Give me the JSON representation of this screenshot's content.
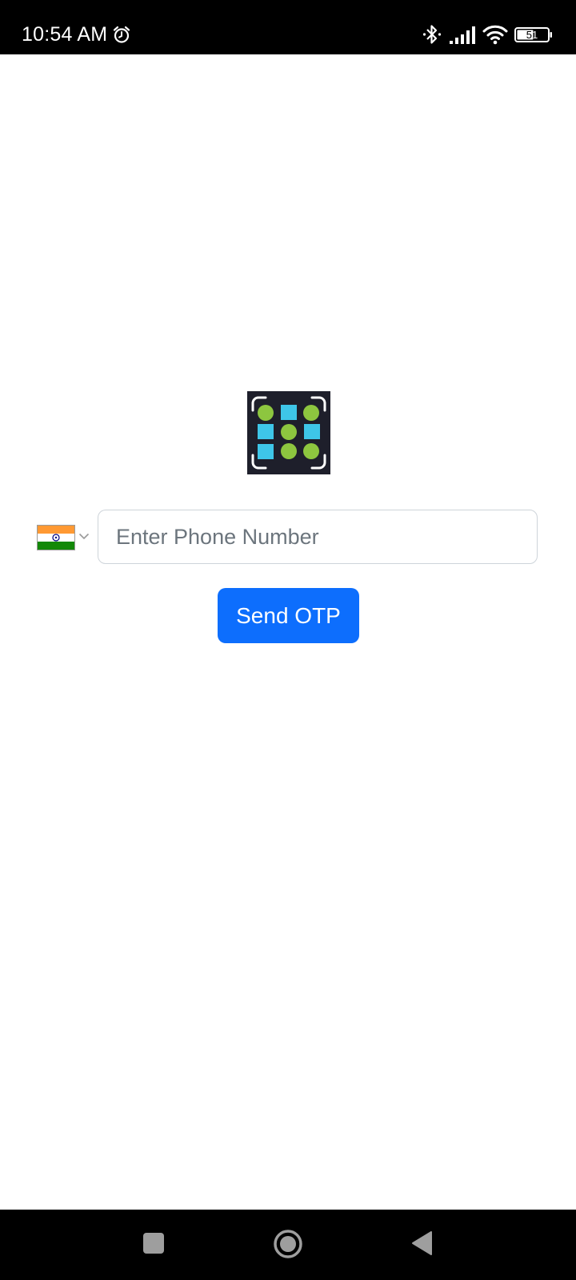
{
  "status_bar": {
    "time": "10:54 AM",
    "battery_level": "51",
    "icons": [
      "alarm-icon",
      "bluetooth-icon",
      "signal-icon",
      "wifi-icon",
      "battery-icon"
    ]
  },
  "app": {
    "logo": "app-logo",
    "logo_colors": {
      "background": "#1e1f2b",
      "circle": "#8dc63f",
      "square": "#3ec6e8"
    }
  },
  "login": {
    "country": {
      "flag": "india-flag",
      "flag_colors": [
        "#ff9933",
        "#ffffff",
        "#138808"
      ]
    },
    "phone_input": {
      "placeholder": "Enter Phone Number",
      "value": ""
    },
    "send_otp_label": "Send OTP",
    "accent_color": "#0d6efd"
  },
  "nav_bar": {
    "buttons": [
      "recent-apps-button",
      "home-button",
      "back-button"
    ]
  }
}
